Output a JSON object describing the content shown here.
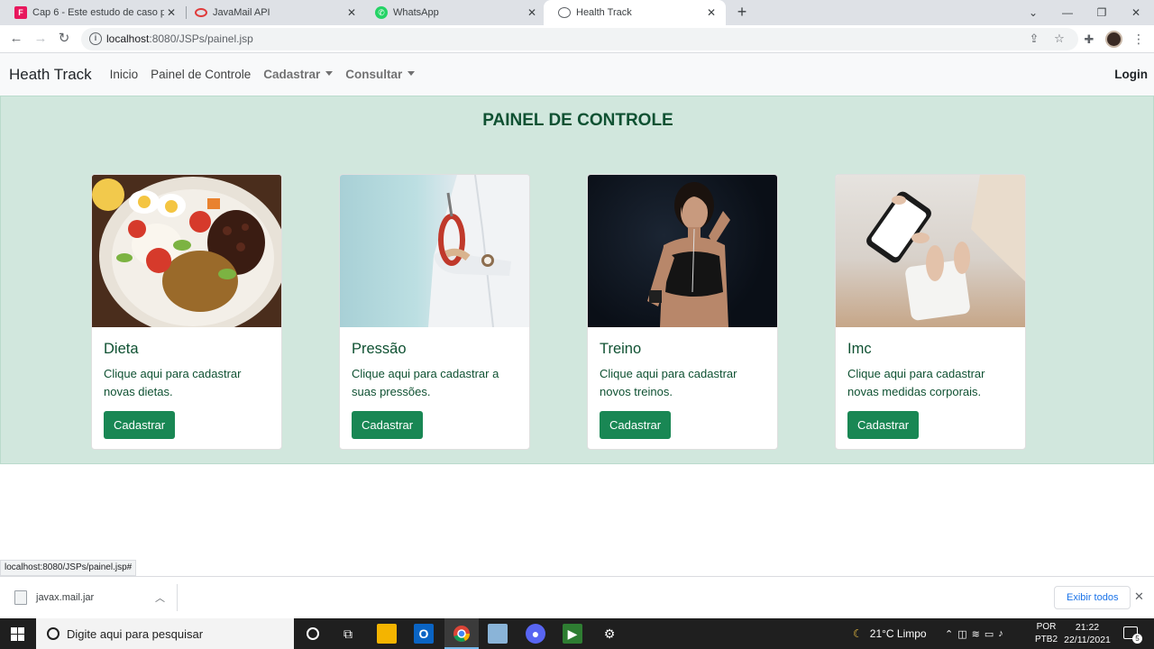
{
  "browser": {
    "tabs": [
      {
        "title": "Cap 6 - Este estudo de caso pode",
        "favicon": "fiap-icon",
        "active": false
      },
      {
        "title": "JavaMail API",
        "favicon": "oracle-icon",
        "active": false
      },
      {
        "title": "WhatsApp",
        "favicon": "whatsapp-icon",
        "active": false
      },
      {
        "title": "Health Track",
        "favicon": "globe-icon",
        "active": true
      }
    ],
    "url_host": "localhost",
    "url_path": ":8080/JSPs/painel.jsp",
    "status_link": "localhost:8080/JSPs/painel.jsp#"
  },
  "navbar": {
    "brand": "Heath Track",
    "links": [
      "Inicio",
      "Painel de Controle"
    ],
    "dropdowns": [
      "Cadastrar",
      "Consultar"
    ],
    "login": "Login"
  },
  "panel": {
    "title": "PAINEL DE CONTROLE",
    "cards": [
      {
        "title": "Dieta",
        "text": "Clique aqui para cadastrar novas dietas.",
        "button": "Cadastrar",
        "image": "food-plate-image"
      },
      {
        "title": "Pressão",
        "text": "Clique aqui para cadastrar a suas pressões.",
        "button": "Cadastrar",
        "image": "doctor-stethoscope-image"
      },
      {
        "title": "Treino",
        "text": "Clique aqui para cadastrar novos treinos.",
        "button": "Cadastrar",
        "image": "woman-workout-image"
      },
      {
        "title": "Imc",
        "text": "Clique aqui para cadastrar novas medidas corporais.",
        "button": "Cadastrar",
        "image": "scale-phone-image"
      }
    ]
  },
  "downloads": {
    "file": "javax.mail.jar",
    "show_all": "Exibir todos"
  },
  "taskbar": {
    "search_placeholder": "Digite aqui para pesquisar",
    "weather": "21°C  Limpo",
    "lang_top": "POR",
    "lang_bottom": "PTB2",
    "time": "21:22",
    "date": "22/11/2021",
    "notifications": "5"
  },
  "colors": {
    "accent_green": "#198754",
    "panel_bg": "#d1e7dd",
    "panel_text": "#0f5132"
  }
}
